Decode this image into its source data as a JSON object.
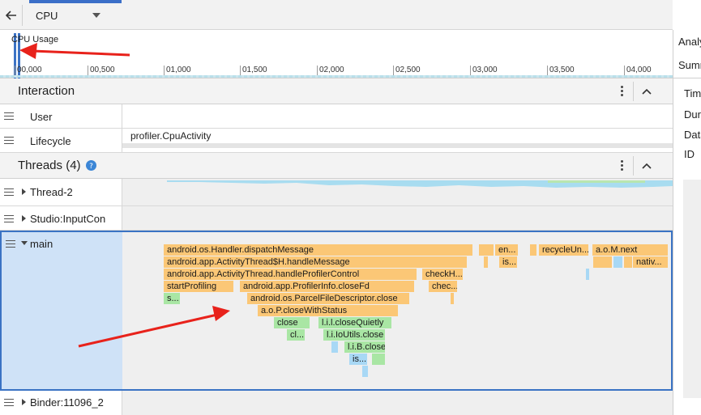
{
  "toolbar": {
    "back_icon": "arrow-left-icon",
    "cpu_select_value": "CPU",
    "dropdown_icon": "chevron-down-icon"
  },
  "cpu_usage": {
    "label": "CPU Usage",
    "ticks": [
      "00,000",
      "00,500",
      "01,000",
      "01,500",
      "02,000",
      "02,500",
      "03,000",
      "03,500",
      "04,000"
    ]
  },
  "interaction": {
    "title": "Interaction",
    "rows": [
      {
        "label": "User",
        "value": ""
      },
      {
        "label": "Lifecycle",
        "value": "profiler.CpuActivity"
      }
    ]
  },
  "threads": {
    "title": "Threads (4)",
    "help_icon": "help-circle-icon",
    "rows": [
      {
        "label": "Thread-2"
      },
      {
        "label": "Studio:InputCon"
      },
      {
        "label": "main"
      },
      {
        "label": "Binder:11096_2"
      }
    ],
    "flame": {
      "row1": [
        "android.os.Handler.dispatchMessage",
        "en...",
        "recycleUn...",
        "a.o.M.next"
      ],
      "row2": [
        "android.app.ActivityThread$H.handleMessage",
        "is...",
        "nativ..."
      ],
      "row3": [
        "android.app.ActivityThread.handleProfilerControl",
        "checkH..."
      ],
      "row4": [
        "startProfiling",
        "android.app.ProfilerInfo.closeFd",
        "chec..."
      ],
      "row5": [
        "s...",
        "android.os.ParcelFileDescriptor.close"
      ],
      "row6": [
        "a.o.P.closeWithStatus"
      ],
      "row7": [
        "close",
        "l.i.l.closeQuietly"
      ],
      "row8": [
        "cl...",
        "l.i.IoUtils.close"
      ],
      "row9": [
        "l.i.B.close"
      ],
      "row10": [
        "is..."
      ]
    }
  },
  "right_panel": {
    "tab1": "Analysis",
    "tab2": "Summary",
    "fields": [
      "Time",
      "Duration",
      "Data",
      "ID"
    ]
  },
  "colors": {
    "method_orange": "#fbc776",
    "method_green": "#a9e6a4",
    "method_blue": "#a8d8f5",
    "selection_blue": "#cfe2f7",
    "accent_blue": "#3b6fc8",
    "annotation_red": "#e8221b"
  }
}
